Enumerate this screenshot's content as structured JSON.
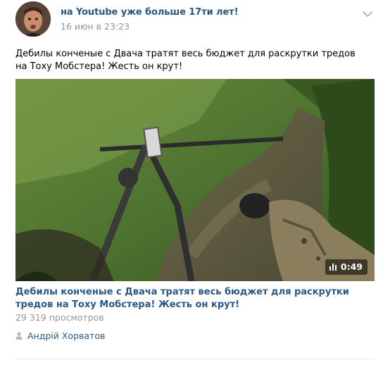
{
  "post": {
    "author": "на Youtube уже больше 17ти лет!",
    "date": "16 июн в 23:23",
    "text": "Дебилы конченые с Двача тратят весь бюджет для раскрутки тредов на Тоху Мобстера! Жесть он крут!",
    "menu_icon": "chevron-down-icon"
  },
  "video": {
    "duration": "0:49",
    "title": "Дебилы конченые с Двача тратят весь бюджет для раскрутки тредов на Тоху Мобстера! Жесть он крут!",
    "views": "29 319 просмотров"
  },
  "signer": {
    "name": "Андрій Хорватов",
    "icon": "person-icon"
  },
  "colors": {
    "link": "#2a5885",
    "meta": "#939393",
    "divider": "#e7e8ec"
  }
}
